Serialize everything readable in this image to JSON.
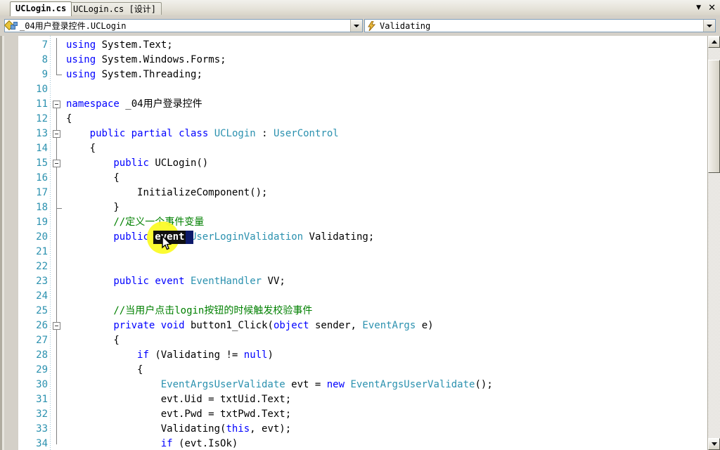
{
  "window": {
    "buttons": [
      {
        "name": "dropdown-chevron",
        "glyph": "▼"
      },
      {
        "name": "close",
        "glyph": "✕"
      }
    ]
  },
  "tabs": [
    {
      "label": "UCLogin.cs",
      "active": true
    },
    {
      "label": "UCLogin.cs [设计]",
      "active": false
    }
  ],
  "navbar": {
    "type_combo": {
      "icon": "class-icon",
      "value": "_04用户登录控件.UCLogin",
      "arrow": "▼"
    },
    "member_combo": {
      "icon": "event-lightning-icon",
      "value": "Validating",
      "arrow": "▼"
    }
  },
  "editor": {
    "first_line_number": 7,
    "selection": {
      "text": "event",
      "line": 20
    },
    "lines": [
      {
        "n": 7,
        "indent": 0,
        "segments": [
          {
            "t": "using ",
            "c": "kw"
          },
          {
            "t": "System.Text;",
            "c": "pl"
          }
        ]
      },
      {
        "n": 8,
        "indent": 0,
        "segments": [
          {
            "t": "using ",
            "c": "kw"
          },
          {
            "t": "System.Windows.Forms;",
            "c": "pl"
          }
        ]
      },
      {
        "n": 9,
        "indent": 0,
        "segments": [
          {
            "t": "using ",
            "c": "kw"
          },
          {
            "t": "System.Threading;",
            "c": "pl"
          }
        ]
      },
      {
        "n": 10,
        "indent": 0,
        "segments": []
      },
      {
        "n": 11,
        "indent": 0,
        "segments": [
          {
            "t": "namespace ",
            "c": "kw"
          },
          {
            "t": "_04用户登录控件",
            "c": "pl"
          }
        ]
      },
      {
        "n": 12,
        "indent": 0,
        "segments": [
          {
            "t": "{",
            "c": "pl"
          }
        ]
      },
      {
        "n": 13,
        "indent": 1,
        "segments": [
          {
            "t": "public partial class ",
            "c": "kw"
          },
          {
            "t": "UCLogin ",
            "c": "ty"
          },
          {
            "t": ": ",
            "c": "pl"
          },
          {
            "t": "UserControl",
            "c": "ty"
          }
        ]
      },
      {
        "n": 14,
        "indent": 1,
        "segments": [
          {
            "t": "{",
            "c": "pl"
          }
        ]
      },
      {
        "n": 15,
        "indent": 2,
        "segments": [
          {
            "t": "public ",
            "c": "kw"
          },
          {
            "t": "UCLogin()",
            "c": "pl"
          }
        ]
      },
      {
        "n": 16,
        "indent": 2,
        "segments": [
          {
            "t": "{",
            "c": "pl"
          }
        ]
      },
      {
        "n": 17,
        "indent": 3,
        "segments": [
          {
            "t": "InitializeComponent();",
            "c": "pl"
          }
        ]
      },
      {
        "n": 18,
        "indent": 2,
        "segments": [
          {
            "t": "}",
            "c": "pl"
          }
        ]
      },
      {
        "n": 19,
        "indent": 2,
        "segments": [
          {
            "t": "//定义一个事件变量",
            "c": "cm"
          }
        ]
      },
      {
        "n": 20,
        "indent": 2,
        "segments": [
          {
            "t": "public ",
            "c": "kw"
          },
          {
            "t": "event ",
            "c": "kw"
          },
          {
            "t": "UserLoginValidation ",
            "c": "ty"
          },
          {
            "t": "Validating;",
            "c": "pl"
          }
        ]
      },
      {
        "n": 21,
        "indent": 0,
        "segments": []
      },
      {
        "n": 22,
        "indent": 0,
        "segments": []
      },
      {
        "n": 23,
        "indent": 2,
        "segments": [
          {
            "t": "public event ",
            "c": "kw"
          },
          {
            "t": "EventHandler ",
            "c": "ty"
          },
          {
            "t": "VV;",
            "c": "pl"
          }
        ]
      },
      {
        "n": 24,
        "indent": 0,
        "segments": []
      },
      {
        "n": 25,
        "indent": 2,
        "segments": [
          {
            "t": "//当用户点击login按钮的时候触发校验事件",
            "c": "cm"
          }
        ]
      },
      {
        "n": 26,
        "indent": 2,
        "segments": [
          {
            "t": "private void ",
            "c": "kw"
          },
          {
            "t": "button1_Click(",
            "c": "pl"
          },
          {
            "t": "object ",
            "c": "kw"
          },
          {
            "t": "sender, ",
            "c": "pl"
          },
          {
            "t": "EventArgs ",
            "c": "ty"
          },
          {
            "t": "e)",
            "c": "pl"
          }
        ]
      },
      {
        "n": 27,
        "indent": 2,
        "segments": [
          {
            "t": "{",
            "c": "pl"
          }
        ]
      },
      {
        "n": 28,
        "indent": 3,
        "segments": [
          {
            "t": "if ",
            "c": "kw"
          },
          {
            "t": "(Validating != ",
            "c": "pl"
          },
          {
            "t": "null",
            "c": "kw"
          },
          {
            "t": ")",
            "c": "pl"
          }
        ]
      },
      {
        "n": 29,
        "indent": 3,
        "segments": [
          {
            "t": "{",
            "c": "pl"
          }
        ]
      },
      {
        "n": 30,
        "indent": 4,
        "segments": [
          {
            "t": "EventArgsUserValidate ",
            "c": "ty"
          },
          {
            "t": "evt = ",
            "c": "pl"
          },
          {
            "t": "new ",
            "c": "kw"
          },
          {
            "t": "EventArgsUserValidate",
            "c": "ty"
          },
          {
            "t": "();",
            "c": "pl"
          }
        ]
      },
      {
        "n": 31,
        "indent": 4,
        "segments": [
          {
            "t": "evt.Uid = txtUid.Text;",
            "c": "pl"
          }
        ]
      },
      {
        "n": 32,
        "indent": 4,
        "segments": [
          {
            "t": "evt.Pwd = txtPwd.Text;",
            "c": "pl"
          }
        ]
      },
      {
        "n": 33,
        "indent": 4,
        "segments": [
          {
            "t": "Validating(",
            "c": "pl"
          },
          {
            "t": "this",
            "c": "kw"
          },
          {
            "t": ", evt);",
            "c": "pl"
          }
        ]
      },
      {
        "n": 34,
        "indent": 4,
        "segments": [
          {
            "t": "if ",
            "c": "kw"
          },
          {
            "t": "(evt.IsOk)",
            "c": "pl"
          }
        ]
      }
    ],
    "fold_boxes": [
      11,
      13,
      15,
      26
    ],
    "fold_end_lines": [
      9,
      18
    ]
  },
  "colors": {
    "keyword": "#0000ff",
    "type": "#2b91af",
    "comment": "#008000",
    "plain": "#000000",
    "line_number": "#2b91af",
    "selection_bg": "#101010",
    "click_highlight": "#fbfb27",
    "chrome": "#d4d0c8"
  },
  "scrollbar": {
    "up_arrow": "▲",
    "down_arrow": "▼"
  }
}
